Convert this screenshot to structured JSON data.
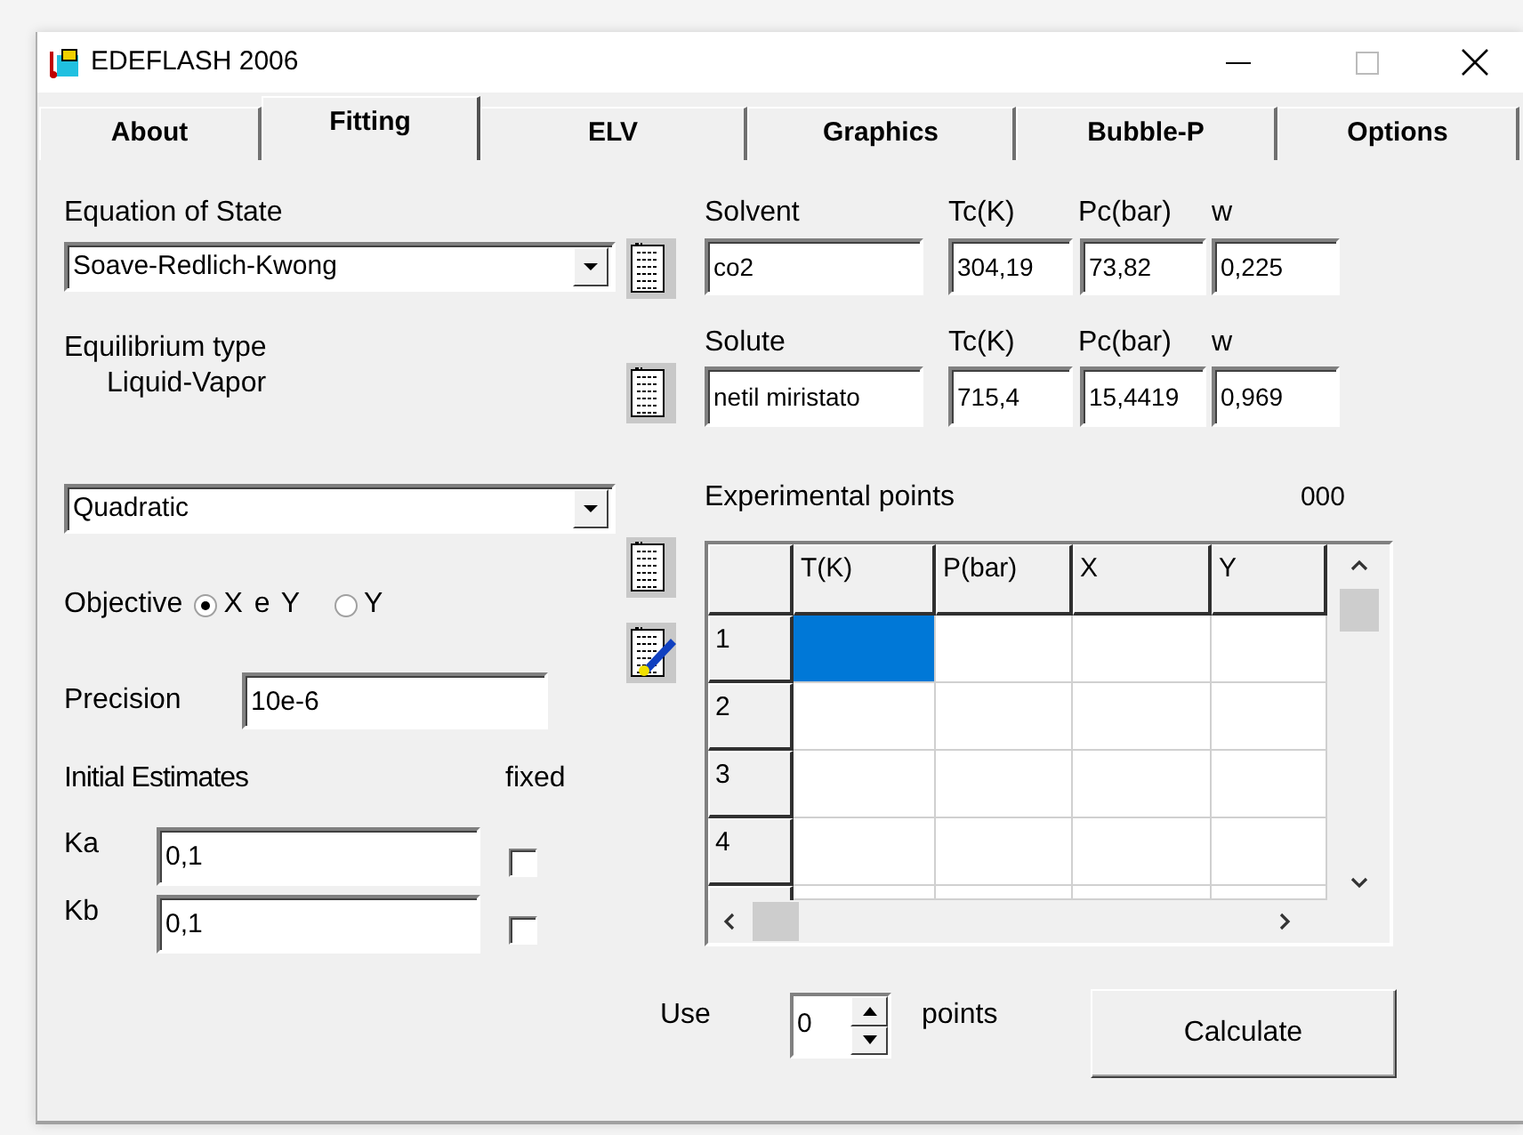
{
  "window": {
    "title": "EDEFLASH 2006"
  },
  "tabs": [
    {
      "label": "About",
      "selected": false
    },
    {
      "label": "Fitting",
      "selected": true
    },
    {
      "label": "ELV",
      "selected": false
    },
    {
      "label": "Graphics",
      "selected": false
    },
    {
      "label": "Bubble-P",
      "selected": false
    },
    {
      "label": "Options",
      "selected": false
    }
  ],
  "equation_of_state": {
    "label": "Equation of State",
    "value": "Soave-Redlich-Kwong"
  },
  "equilibrium": {
    "label": "Equilibrium type",
    "value": "Liquid-Vapor"
  },
  "fit_model": {
    "value": "Quadratic"
  },
  "objective": {
    "label": "Objective",
    "options": [
      {
        "label": "X e Y",
        "selected": true
      },
      {
        "label": "Y",
        "selected": false
      }
    ]
  },
  "precision": {
    "label": "Precision",
    "value": "10e-6"
  },
  "initial_estimates": {
    "label": "Initial Estimates",
    "fixed_label": "fixed",
    "params": [
      {
        "label": "Ka",
        "value": "0,1",
        "fixed": false
      },
      {
        "label": "Kb",
        "value": "0,1",
        "fixed": false
      }
    ]
  },
  "components": [
    {
      "label": "Solvent",
      "tc_label": "Tc(K)",
      "pc_label": "Pc(bar)",
      "w_label": "w",
      "name": "co2",
      "tc": "304,19",
      "pc": "73,82",
      "w": "0,225"
    },
    {
      "label": "Solute",
      "tc_label": "Tc(K)",
      "pc_label": "Pc(bar)",
      "w_label": "w",
      "name": "netil miristato",
      "tc": "715,4",
      "pc": "15,4419",
      "w": "0,969"
    }
  ],
  "experimental_points": {
    "label": "Experimental points",
    "count": "000"
  },
  "table": {
    "columns": [
      "T(K)",
      "P(bar)",
      "X",
      "Y"
    ],
    "rows": [
      {
        "label": "1",
        "cells": [
          {
            "selected": true
          },
          {
            "selected": false
          },
          {
            "selected": false
          },
          {
            "selected": false
          }
        ]
      },
      {
        "label": "2",
        "cells": [
          {
            "selected": false
          },
          {
            "selected": false
          },
          {
            "selected": false
          },
          {
            "selected": false
          }
        ]
      },
      {
        "label": "3",
        "cells": [
          {
            "selected": false
          },
          {
            "selected": false
          },
          {
            "selected": false
          },
          {
            "selected": false
          }
        ]
      },
      {
        "label": "4",
        "cells": [
          {
            "selected": false
          },
          {
            "selected": false
          },
          {
            "selected": false
          },
          {
            "selected": false
          }
        ]
      },
      {
        "cells": [
          {
            "selected": false
          },
          {
            "selected": false
          },
          {
            "selected": false
          },
          {
            "selected": false
          }
        ]
      }
    ]
  },
  "use_points": {
    "label": "Use",
    "value": "0",
    "unit": "points"
  },
  "calculate_button": {
    "label": "Calculate"
  }
}
